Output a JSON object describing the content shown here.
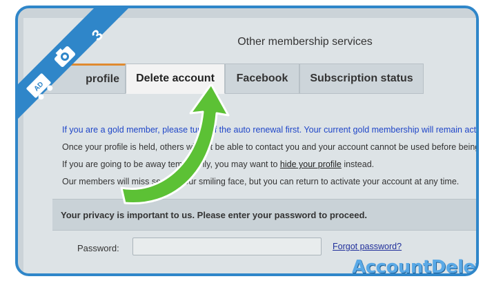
{
  "header": {
    "section_title": "Other membership services"
  },
  "tabs": [
    {
      "label": "profile"
    },
    {
      "label": "Delete account"
    },
    {
      "label": "Facebook"
    },
    {
      "label": "Subscription status"
    }
  ],
  "info": {
    "line1": "If you are a gold member, please turn off the auto renewal first. Your current gold membership will remain active",
    "line2": "Once your profile is held, others will not be able to contact you and your account cannot be used before being",
    "line3_before": "If you are going to be away temporarily, you may want to ",
    "line3_link": "hide your profile",
    "line3_after": " instead.",
    "line4": "Our members will miss seeing your smiling face, but you can return to activate your account at any time."
  },
  "privacy": {
    "message": "Your privacy is important to us. Please enter your password to proceed."
  },
  "password": {
    "label": "Password:",
    "value": "",
    "forgot_link": "Forgot password?"
  },
  "ribbon": {
    "step_number": "3",
    "logo_text": "AD"
  },
  "brand": {
    "text": "AccountDeleters"
  },
  "colors": {
    "ribbon_blue": "#2f86c9",
    "arrow_green": "#5cc135",
    "active_tab_accent": "#e08a2f"
  },
  "icons": {
    "step": "camera-icon",
    "arrow": "curved-arrow-icon"
  }
}
